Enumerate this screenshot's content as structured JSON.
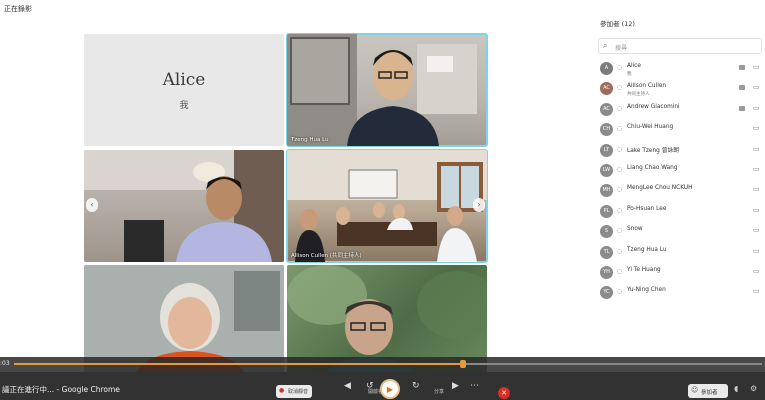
{
  "app": {
    "title": "正在錄影"
  },
  "tiles": {
    "alice_name": "Alice",
    "alice_me": "我",
    "t2_name": "Tzeng Hua Lu",
    "t4_name": "Allison Cullen (共同主持人)"
  },
  "panel": {
    "title": "參加者 (12)",
    "search_placeholder": "搜尋",
    "participants": [
      {
        "initials": "A",
        "name": "Alice",
        "sub": "我",
        "color": "#7c7c7c"
      },
      {
        "initials": "AC",
        "name": "Allison Cullen",
        "sub": "共同主持人",
        "color": "#9e6b5a"
      },
      {
        "initials": "AC",
        "name": "Andrew Giacomini",
        "sub": "",
        "color": "#8b8b8b"
      },
      {
        "initials": "CH",
        "name": "Chiu-Wei Huang",
        "sub": "",
        "color": "#8b8b8b"
      },
      {
        "initials": "LT",
        "name": "Lake Tzeng 曾詠朗",
        "sub": "",
        "color": "#8b8b8b"
      },
      {
        "initials": "LW",
        "name": "Liang Chao Wang",
        "sub": "",
        "color": "#8b8b8b"
      },
      {
        "initials": "MH",
        "name": "MengLee Chou NCKUH",
        "sub": "",
        "color": "#8b8b8b"
      },
      {
        "initials": "PL",
        "name": "Po-Hsuan Lee",
        "sub": "",
        "color": "#8b8b8b"
      },
      {
        "initials": "S",
        "name": "Snow",
        "sub": "",
        "color": "#8b8b8b"
      },
      {
        "initials": "TL",
        "name": "Tzeng Hua Lu",
        "sub": "",
        "color": "#8b8b8b"
      },
      {
        "initials": "YH",
        "name": "Yi Te Huang",
        "sub": "",
        "color": "#8b8b8b"
      },
      {
        "initials": "YC",
        "name": "Yu-Ning Chen",
        "sub": "",
        "color": "#8b8b8b"
      }
    ]
  },
  "player": {
    "time": ":03",
    "progress": 0.6
  },
  "taskbar": {
    "window_title": "議正在進行中... - Google Chrome",
    "chip1": "取消靜音",
    "chip2": "開啟視訊",
    "chip3": "分享",
    "participants_label": "參加者"
  }
}
